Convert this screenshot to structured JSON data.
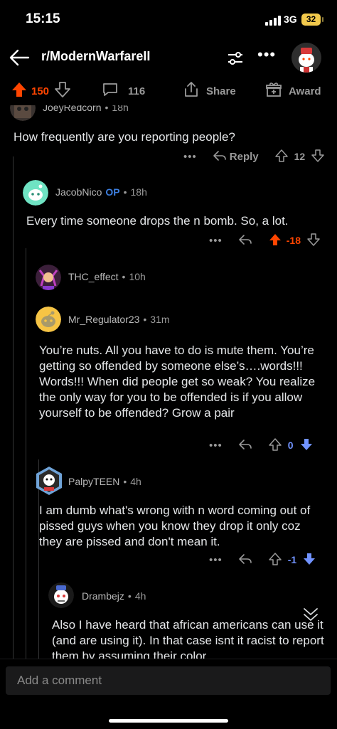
{
  "status": {
    "time": "15:15",
    "network": "3G",
    "battery": "32"
  },
  "header": {
    "subreddit": "r/ModernWarfareII"
  },
  "post_actions": {
    "upvotes": "150",
    "comments": "116",
    "share": "Share",
    "award": "Award"
  },
  "comments": [
    {
      "user": "JoeyRedcorn",
      "time": "18h",
      "body": "How frequently are you reporting people?",
      "reply": "Reply",
      "score": "12"
    },
    {
      "user": "JacobNico",
      "op": "OP",
      "time": "18h",
      "body": "Every time someone drops the n bomb. So, a lot.",
      "score": "-18"
    },
    {
      "user": "THC_effect",
      "time": "10h"
    },
    {
      "user": "Mr_Regulator23",
      "time": "31m",
      "body": "You’re nuts. All you have to do is mute them. You’re getting so offended by someone else’s….words!!! Words!!! When did people get so weak? You realize the only way for you to be offended is if you allow yourself to be offended? Grow a pair",
      "score": "0"
    },
    {
      "user": "PalpyTEEN",
      "time": "4h",
      "body": "I am dumb what's wrong with n word coming out of pissed guys when you know they drop it only coz they are pissed and don't mean it.",
      "score": "-1"
    },
    {
      "user": "Drambejz",
      "time": "4h",
      "body": "Also I have heard that african americans can use it (and are using it). In that case isnt it racist to report them by assuming their color"
    }
  ],
  "composer": {
    "placeholder": "Add a comment"
  },
  "colors": {
    "upvote": "#ff4500",
    "downvote": "#7193ff",
    "op": "#3d7fe0",
    "background": "#000000"
  },
  "icons": [
    "back-arrow-icon",
    "sort-icon",
    "more-icon",
    "upvote-icon",
    "downvote-icon",
    "comment-icon",
    "share-icon",
    "award-icon",
    "reply-icon",
    "collapse-icon"
  ]
}
